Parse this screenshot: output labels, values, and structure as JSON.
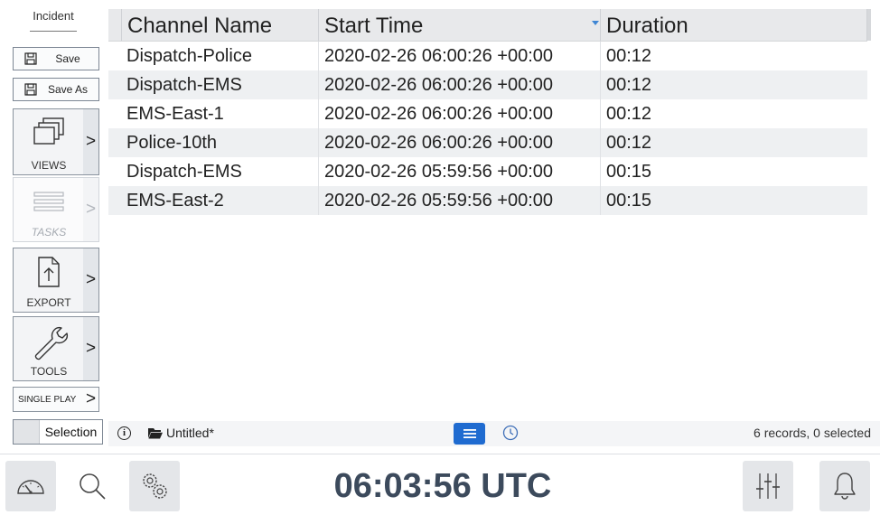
{
  "sidebar": {
    "incident_title": "Incident",
    "save_label": "Save",
    "save_as_label": "Save As",
    "views_label": "VIEWS",
    "tasks_label": "TASKS",
    "export_label": "EXPORT",
    "tools_label": "TOOLS",
    "single_play_label": "SINGLE PLAY",
    "chevron": ">",
    "selection_label": "Selection"
  },
  "table": {
    "columns": [
      "Channel Name",
      "Start Time",
      "Duration"
    ],
    "sorted_column": "Start Time",
    "sort_direction": "descending",
    "rows": [
      {
        "channel": "Dispatch-Police",
        "start": "2020-02-26 06:00:26 +00:00",
        "duration": "00:12"
      },
      {
        "channel": "Dispatch-EMS",
        "start": "2020-02-26 06:00:26 +00:00",
        "duration": "00:12"
      },
      {
        "channel": "EMS-East-1",
        "start": "2020-02-26 06:00:26 +00:00",
        "duration": "00:12"
      },
      {
        "channel": "Police-10th",
        "start": "2020-02-26 06:00:26 +00:00",
        "duration": "00:12"
      },
      {
        "channel": "Dispatch-EMS",
        "start": "2020-02-26 05:59:56 +00:00",
        "duration": "00:15"
      },
      {
        "channel": "EMS-East-2",
        "start": "2020-02-26 05:59:56 +00:00",
        "duration": "00:15"
      }
    ]
  },
  "status": {
    "info_glyph": "i",
    "filename": "Untitled*",
    "records": "6 records, 0 selected"
  },
  "bottom": {
    "time": "06:03:56 UTC"
  },
  "colors": {
    "accent": "#1f6bd0",
    "clock_text": "#3c4a5c",
    "header_bg": "#e8e9eb",
    "alt_row_bg": "#eef0f2"
  }
}
